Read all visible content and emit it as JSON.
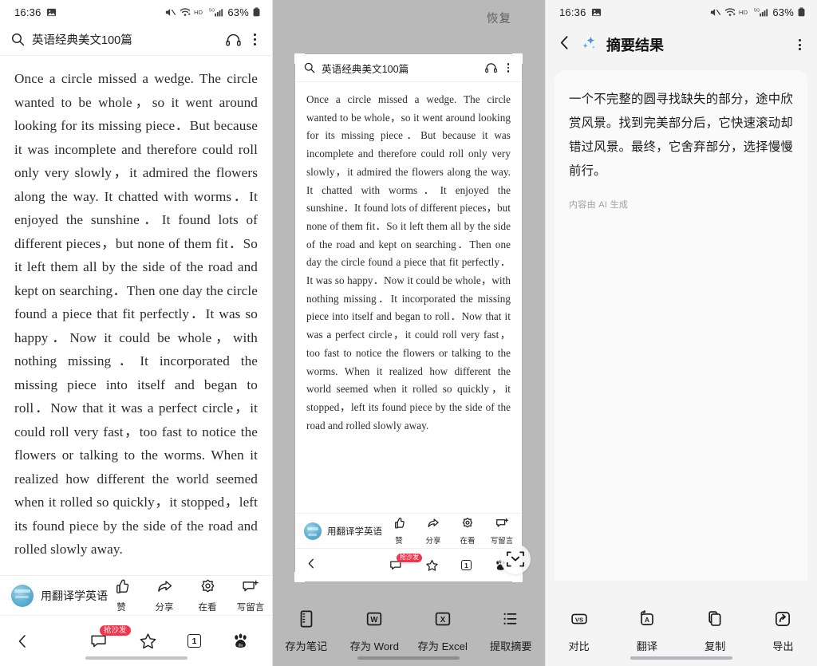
{
  "statusbar": {
    "clock": "16:36",
    "battery_percent": "63%",
    "icons": [
      "photo-icon",
      "mute-icon",
      "wifi-icon",
      "hd-icon",
      "signal-5g-icon",
      "battery-icon"
    ]
  },
  "left_panel": {
    "search": {
      "value": "英语经典美文100篇",
      "icon": "search-icon"
    },
    "headphone_icon": "headphone-icon",
    "more_icon": "more-vertical-icon",
    "article": "Once a circle missed a wedge. The circle wanted to be whole，so it went around looking for its missing piece．But because it was incomplete and therefore could roll only very slowly，it admired the flowers along the way. It chatted with worms．It enjoyed the sunshine．It found lots of different pieces，but none of them fit．So it left them all by the side of the road and kept on searching．Then one day the circle found a piece that fit perfectly．It was so happy．Now it could be whole，with nothing missing．It incorporated the missing piece into itself and began to roll．Now that it was a perfect circle，it could roll very fast，too fast to notice the flowers or talking to the worms. When it realized how different the world seemed when it rolled so quickly，it stopped，left its found piece by the side of the road and rolled slowly away.",
    "author": {
      "name": "用翻译学英语",
      "avatar": "avatar"
    },
    "actions": [
      {
        "label": "赞",
        "icon": "thumbs-up-icon"
      },
      {
        "label": "分享",
        "icon": "share-icon"
      },
      {
        "label": "在看",
        "icon": "wow-icon"
      },
      {
        "label": "写留言",
        "icon": "comment-plus-icon"
      }
    ],
    "bottom_nav": {
      "back_icon": "chevron-left-icon",
      "comment_icon": "comment-icon",
      "comment_badge": "抢沙发",
      "star_icon": "star-icon",
      "tabs_count": "1",
      "baidu_icon": "baidu-paw-icon"
    }
  },
  "mid_panel": {
    "restore_label": "恢复",
    "selection": {
      "search": {
        "value": "英语经典美文100篇",
        "icon": "search-icon"
      },
      "headphone_icon": "headphone-icon",
      "more_icon": "more-vertical-icon",
      "article": "Once a circle missed a wedge. The circle wanted to be whole，so it went around looking for its missing piece．But because it was incomplete and therefore could roll only very slowly，it admired the flowers along the way. It chatted with worms．It enjoyed the sunshine．It found lots of different pieces，but none of them fit．So it left them all by the side of the road and kept on searching．Then one day the circle found a piece that fit perfectly．It was so happy．Now it could be whole，with nothing missing．It incorporated the missing piece into itself and began to roll．Now that it was a perfect circle，it could roll very fast，too fast to notice the flowers or talking to the worms. When it realized how different the world seemed when it rolled so quickly，it stopped，left its found piece by the side of the road and rolled slowly away.",
      "author": {
        "name": "用翻译学英语"
      },
      "actions": [
        {
          "label": "赞",
          "icon": "thumbs-up-icon"
        },
        {
          "label": "分享",
          "icon": "share-icon"
        },
        {
          "label": "在看",
          "icon": "wow-icon"
        },
        {
          "label": "写留言",
          "icon": "comment-plus-icon"
        }
      ],
      "bottom_nav": {
        "back_icon": "chevron-left-icon",
        "comment_badge": "抢沙发",
        "tabs_count": "1"
      },
      "drag_handle_icon": "scan-expand-icon"
    },
    "toolbar": [
      {
        "label": "存为笔记",
        "icon": "note-icon"
      },
      {
        "label": "存为 Word",
        "icon": "word-icon"
      },
      {
        "label": "存为 Excel",
        "icon": "excel-icon"
      },
      {
        "label": "提取摘要",
        "icon": "list-icon"
      }
    ]
  },
  "right_panel": {
    "back_icon": "chevron-left-icon",
    "sparkle_icon": "ai-sparkle-icon",
    "title": "摘要结果",
    "more_icon": "more-vertical-icon",
    "summary": "一个不完整的圆寻找缺失的部分，途中欣赏风景。找到完美部分后，它快速滚动却错过风景。最终，它舍弃部分，选择慢慢前行。",
    "note": "内容由 AI 生成",
    "toolbar": [
      {
        "label": "对比",
        "icon": "vs-icon"
      },
      {
        "label": "翻译",
        "icon": "translate-icon"
      },
      {
        "label": "复制",
        "icon": "copy-icon"
      },
      {
        "label": "导出",
        "icon": "export-icon"
      }
    ]
  },
  "colors": {
    "badge_red": "#f5334d",
    "overlay_gray": "#b9b9b9",
    "sparkle_blue": "#4a90e2",
    "panel_bg": "#f4f4f5"
  }
}
